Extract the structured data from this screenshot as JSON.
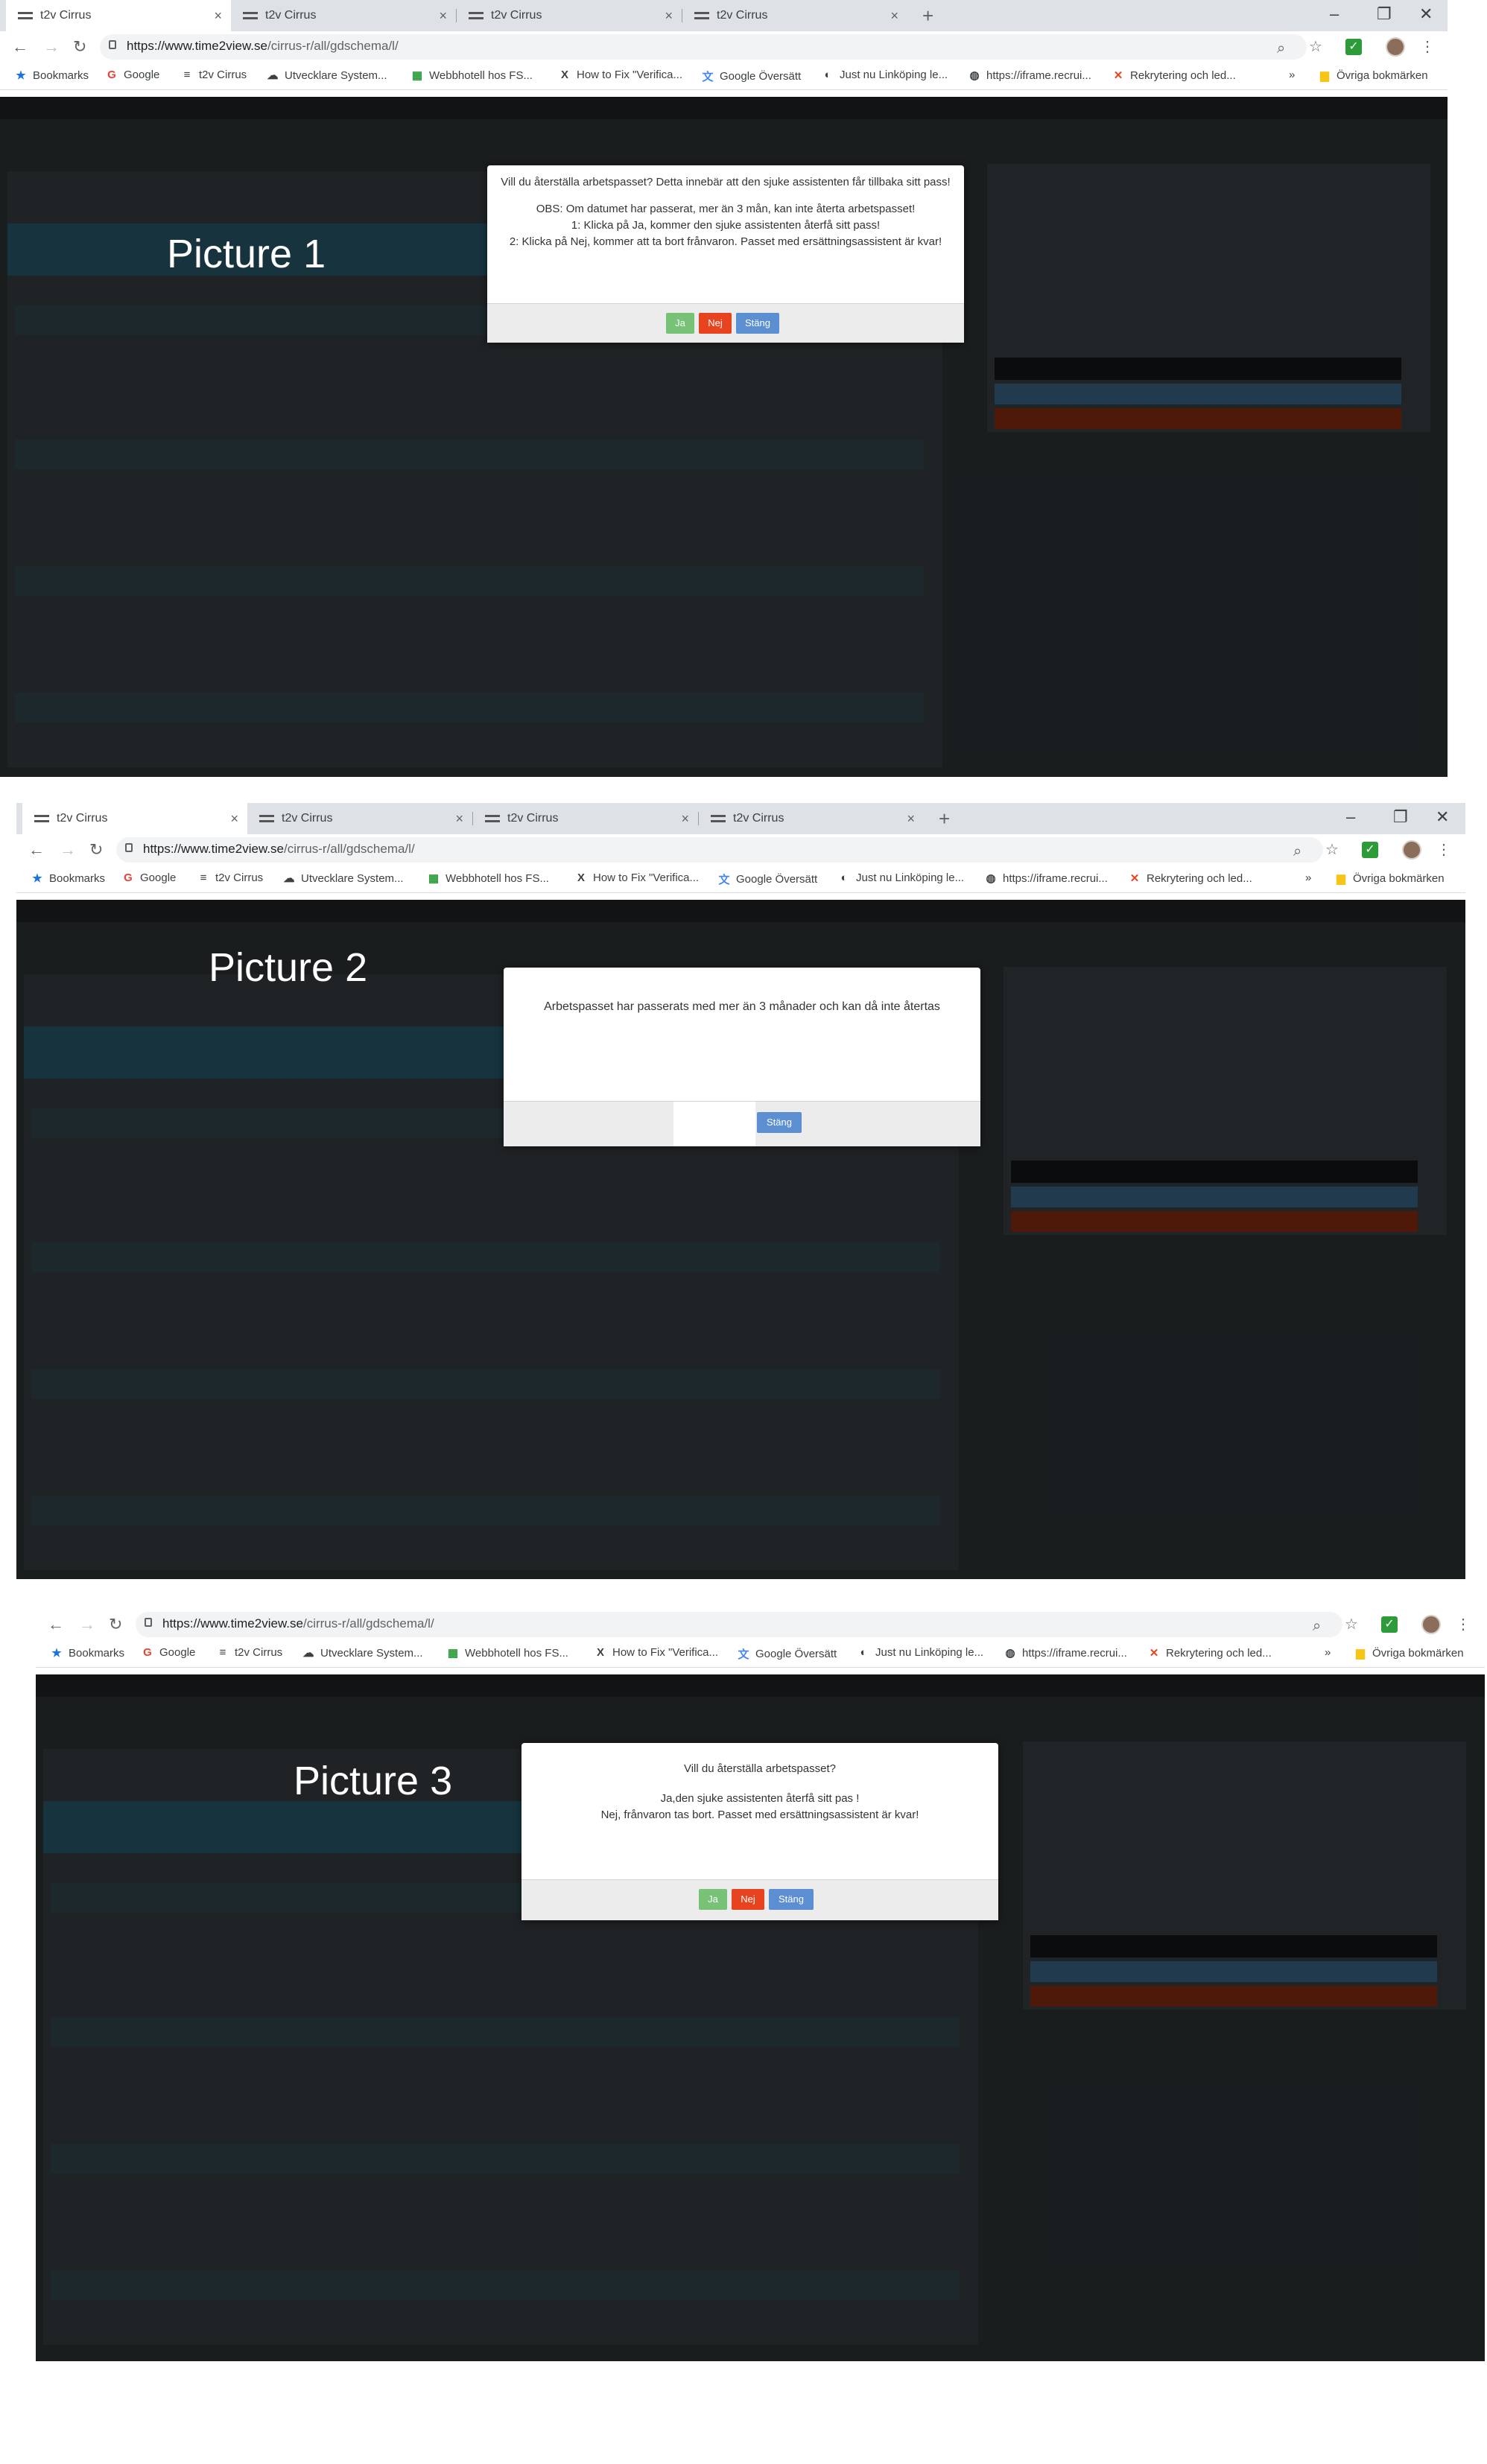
{
  "browser": {
    "tabs": [
      "t2v Cirrus",
      "t2v Cirrus",
      "t2v Cirrus",
      "t2v Cirrus"
    ],
    "url_host": "https://www.time2view.se",
    "url_path": "/cirrus-r/all/gdschema/l/",
    "bookmarks": [
      "Bookmarks",
      "Google",
      "t2v Cirrus",
      "Utvecklare System...",
      "Webbhotell hos FS...",
      "How to Fix \"Verifica...",
      "Google Översätt",
      "Just nu Linköping le...",
      "https://iframe.recrui...",
      "Rekrytering och led..."
    ],
    "other_bookmarks": "Övriga bokmärken",
    "more": "»"
  },
  "icons": {
    "back": "arrow-left-icon",
    "forward": "arrow-right-icon",
    "reload": "reload-icon",
    "zoom": "magnifier-icon",
    "star": "star-icon",
    "menu": "kebab-menu-icon",
    "minimize": "minimize-icon",
    "restore": "restore-icon",
    "close": "close-icon"
  },
  "colors": {
    "ja": "#5cb85c",
    "nej": "#e8431f",
    "stang": "#5b8fd1",
    "app_bg": "#2f3538"
  },
  "pictures": [
    {
      "label": "Picture 1",
      "dialog": {
        "lines": [
          "Vill du återställa arbetspasset? Detta innebär att den sjuke assistenten får tillbaka sitt pass!",
          "",
          "OBS: Om datumet har passerat, mer än 3 mån, kan inte återta arbetspasset!",
          "1: Klicka på Ja, kommer den sjuke assistenten återfå sitt pass!",
          "2: Klicka på Nej, kommer att ta bort frånvaron. Passet med ersättningsassistent är kvar!"
        ],
        "buttons": {
          "ja": "Ja",
          "nej": "Nej",
          "stang": "Stäng"
        }
      }
    },
    {
      "label": "Picture 2",
      "dialog": {
        "message": "Arbetspasset har passerats med mer än 3 månader och kan då inte återtas",
        "buttons": {
          "stang": "Stäng"
        }
      }
    },
    {
      "label": "Picture 3",
      "dialog": {
        "lines": [
          "Vill du återställa arbetspasset?",
          "",
          "Ja,den sjuke assistenten återfå sitt pas !",
          "Nej, frånvaron tas bort. Passet med ersättningsassistent är kvar!"
        ],
        "buttons": {
          "ja": "Ja",
          "nej": "Nej",
          "stang": "Stäng"
        }
      }
    }
  ]
}
